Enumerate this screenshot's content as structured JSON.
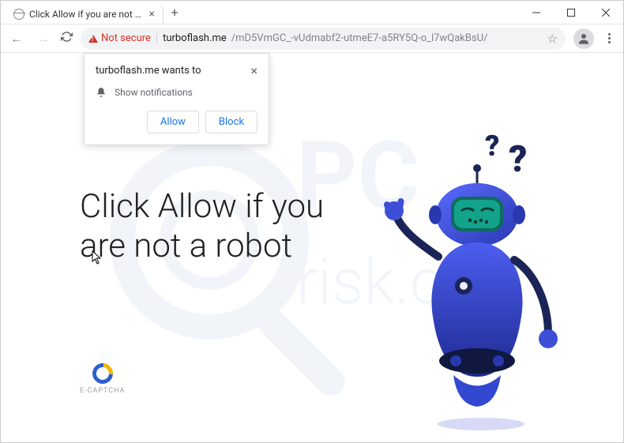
{
  "tab": {
    "title": "Click Allow if you are not a robot"
  },
  "address": {
    "not_secure": "Not secure",
    "host": "turboflash.me",
    "path": "/mD5VmGC_-vUdmabf2-utmeE7-a5RY5Q-o_l7wQakBsU/"
  },
  "popup": {
    "title": "turboflash.me wants to",
    "permission": "Show notifications",
    "allow": "Allow",
    "block": "Block"
  },
  "page": {
    "heading": "Click Allow if you are not a robot",
    "captcha_label": "E-CAPTCHA"
  },
  "watermark": {
    "text": "PCrisk.com"
  }
}
